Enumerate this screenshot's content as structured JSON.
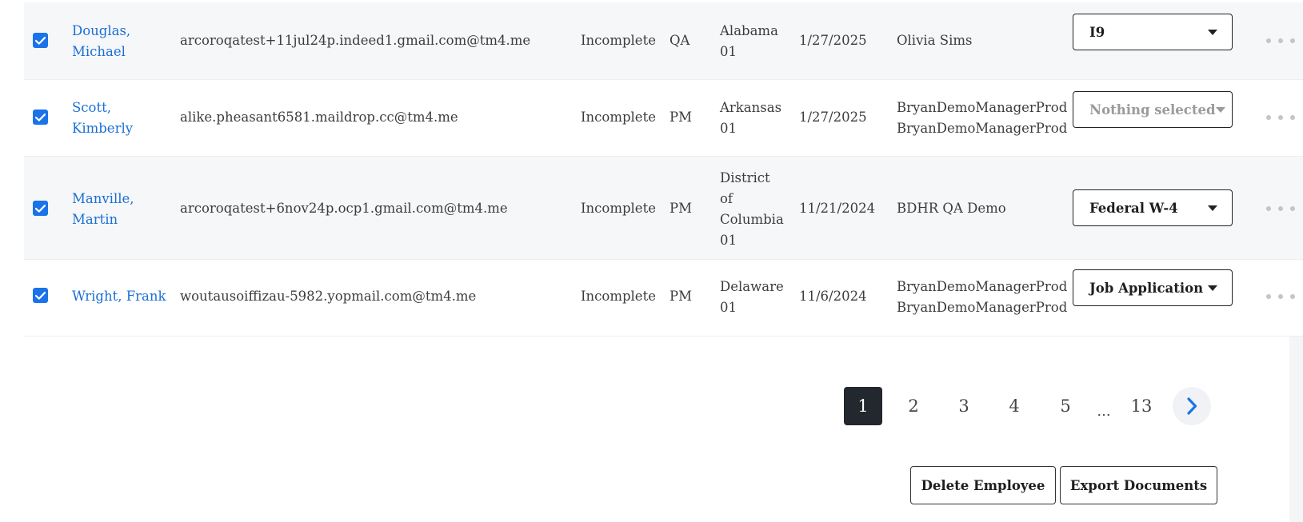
{
  "rows": [
    {
      "checked": true,
      "name": "Douglas, Michael",
      "email": "arcoroqatest+11jul24p.indeed1.gmail.com@tm4.me",
      "status": "Incomplete",
      "role": "QA",
      "location": "Alabama 01",
      "date": "1/27/2025",
      "manager": "Olivia Sims",
      "document": "I9"
    },
    {
      "checked": true,
      "name": "Scott, Kimberly",
      "email": "alike.pheasant6581.maildrop.cc@tm4.me",
      "status": "Incomplete",
      "role": "PM",
      "location": "Arkansas 01",
      "date": "1/27/2025",
      "manager": "BryanDemoManagerProd BryanDemoManagerProd",
      "document": "Nothing selected"
    },
    {
      "checked": true,
      "name": "Manville, Martin",
      "email": "arcoroqatest+6nov24p.ocp1.gmail.com@tm4.me",
      "status": "Incomplete",
      "role": "PM",
      "location": "District of Columbia 01",
      "date": "11/21/2024",
      "manager": "BDHR QA Demo",
      "document": "Federal W-4"
    },
    {
      "checked": true,
      "name": "Wright, Frank",
      "email": "woutausoiffizau-5982.yopmail.com@tm4.me",
      "status": "Incomplete",
      "role": "PM",
      "location": "Delaware 01",
      "date": "11/6/2024",
      "manager": "BryanDemoManagerProd BryanDemoManagerProd",
      "document": "Job Application"
    }
  ],
  "pagination": {
    "pages": [
      "1",
      "2",
      "3",
      "4",
      "5"
    ],
    "ellipsis": "...",
    "last": "13",
    "current": "1"
  },
  "actions": {
    "delete_label": "Delete Employee",
    "export_label": "Export Documents"
  },
  "colors": {
    "accent": "#1a73e8",
    "link": "#1a6fd6",
    "active_page": "#23272e"
  },
  "icons": {
    "checkbox": "checkbox-checked-icon",
    "caret": "chevron-down-icon",
    "more": "more-horizontal-icon",
    "next": "chevron-right-icon"
  }
}
